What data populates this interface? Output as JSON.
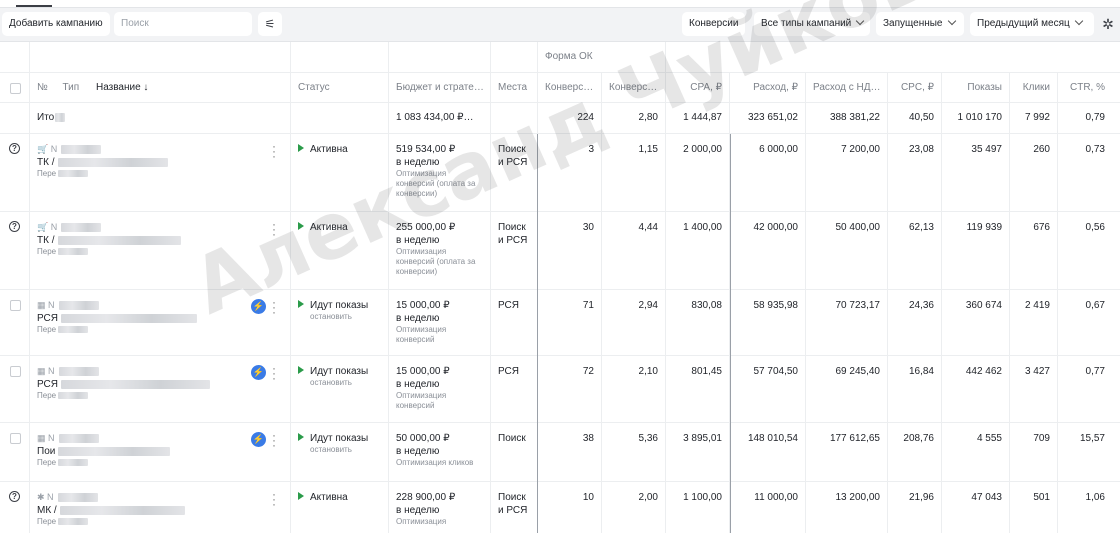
{
  "toolbar": {
    "add_campaign": "Добавить кампанию",
    "search_placeholder": "Поиск",
    "conversions": "Конверсии",
    "campaign_types": "Все типы кампаний",
    "launched": "Запущенные",
    "period": "Предыдущий месяц"
  },
  "header_group": "Форма ОК",
  "columns": {
    "no": "№",
    "type": "Тип",
    "name": "Название ↓",
    "status": "Статус",
    "budget": "Бюджет и страте…",
    "places": "Места",
    "conv1": "Конверс…",
    "conv2": "Конверс…",
    "cpa": "CPA, ₽",
    "spend": "Расход, ₽",
    "spend_vat": "Расход с НД…",
    "cpc": "CPC, ₽",
    "impressions": "Показы",
    "clicks": "Клики",
    "ctr": "CTR, %"
  },
  "totals": {
    "label": "Ито",
    "budget": "1 083 434,00 ₽…",
    "conv1": "224",
    "conv2": "2,80",
    "cpa": "1 444,87",
    "spend": "323 651,02",
    "spend_vat": "388 381,22",
    "cpc": "40,50",
    "impressions": "1 010 170",
    "clicks": "7 992",
    "ctr": "0,79"
  },
  "rows": [
    {
      "icon": "🛒 N",
      "type": "ТК /",
      "sub": "Пере",
      "status": "Активна",
      "status_sub": "",
      "budget": "519 534,00 ₽",
      "budget_period": "в неделю",
      "strategy": "Оптимизация конверсий (оплата за конверсии)",
      "places": "Поиск и РСЯ",
      "conv1": "3",
      "conv2": "1,15",
      "cpa": "2 000,00",
      "spend": "6 000,00",
      "spend_vat": "7 200,00",
      "cpc": "23,08",
      "impressions": "35 497",
      "clicks": "260",
      "ctr": "0,73"
    },
    {
      "icon": "🛒 N",
      "type": "ТК /",
      "sub": "Пере",
      "status": "Активна",
      "status_sub": "",
      "budget": "255 000,00 ₽",
      "budget_period": "в неделю",
      "strategy": "Оптимизация конверсий (оплата за конверсии)",
      "places": "Поиск и РСЯ",
      "conv1": "30",
      "conv2": "4,44",
      "cpa": "1 400,00",
      "spend": "42 000,00",
      "spend_vat": "50 400,00",
      "cpc": "62,13",
      "impressions": "119 939",
      "clicks": "676",
      "ctr": "0,56"
    },
    {
      "icon": "▦ N",
      "type": "РСЯ",
      "sub": "Пере",
      "status": "Идут показы",
      "status_sub": "остановить",
      "budget": "15 000,00 ₽",
      "budget_period": "в неделю",
      "strategy": "Оптимизация конверсий",
      "places": "РСЯ",
      "conv1": "71",
      "conv2": "2,94",
      "cpa": "830,08",
      "spend": "58 935,98",
      "spend_vat": "70 723,17",
      "cpc": "24,36",
      "impressions": "360 674",
      "clicks": "2 419",
      "ctr": "0,67"
    },
    {
      "icon": "▦ N",
      "type": "РСЯ",
      "sub": "Пере",
      "status": "Идут показы",
      "status_sub": "остановить",
      "budget": "15 000,00 ₽",
      "budget_period": "в неделю",
      "strategy": "Оптимизация конверсий",
      "places": "РСЯ",
      "conv1": "72",
      "conv2": "2,10",
      "cpa": "801,45",
      "spend": "57 704,50",
      "spend_vat": "69 245,40",
      "cpc": "16,84",
      "impressions": "442 462",
      "clicks": "3 427",
      "ctr": "0,77"
    },
    {
      "icon": "▦ N",
      "type": "Пои",
      "sub": "Пере",
      "status": "Идут показы",
      "status_sub": "остановить",
      "budget": "50 000,00 ₽",
      "budget_period": "в неделю",
      "strategy": "Оптимизация кликов",
      "places": "Поиск",
      "conv1": "38",
      "conv2": "5,36",
      "cpa": "3 895,01",
      "spend": "148 010,54",
      "spend_vat": "177 612,65",
      "cpc": "208,76",
      "impressions": "4 555",
      "clicks": "709",
      "ctr": "15,57"
    },
    {
      "icon": "✱ N",
      "type": "МК /",
      "sub": "Пере",
      "status": "Активна",
      "status_sub": "",
      "budget": "228 900,00 ₽",
      "budget_period": "в неделю",
      "strategy": "Оптимизация",
      "places": "Поиск и РСЯ",
      "conv1": "10",
      "conv2": "2,00",
      "cpa": "1 100,00",
      "spend": "11 000,00",
      "spend_vat": "13 200,00",
      "cpc": "21,96",
      "impressions": "47 043",
      "clicks": "501",
      "ctr": "1,06"
    }
  ],
  "watermark": "Александ Чуйков"
}
